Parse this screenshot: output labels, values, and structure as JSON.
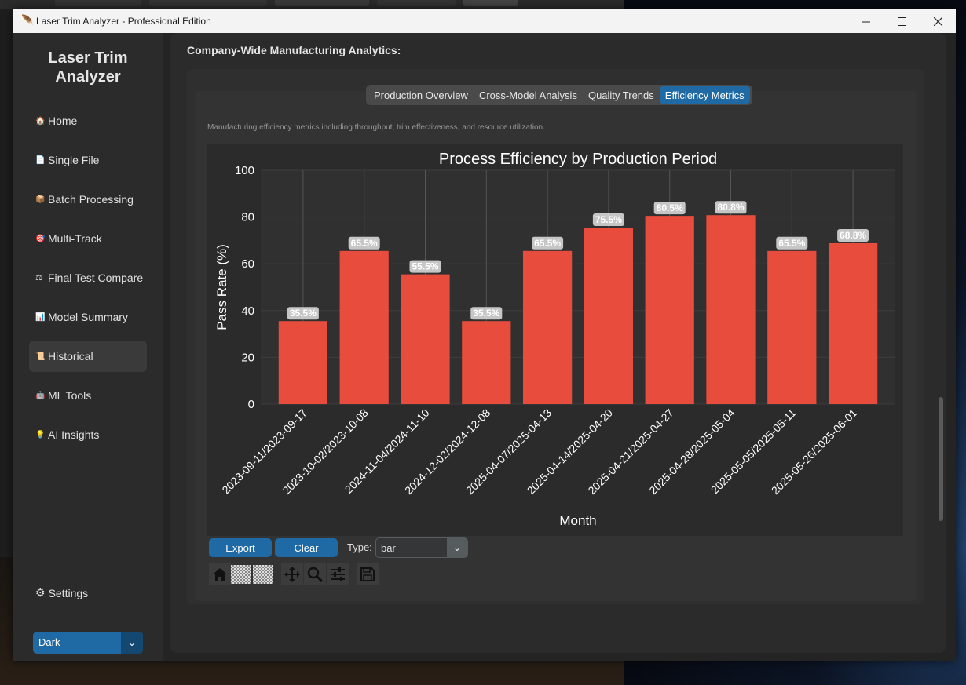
{
  "window": {
    "title": "Laser Trim Analyzer - Professional Edition"
  },
  "sidebar": {
    "app_name": "Laser Trim Analyzer",
    "items": [
      {
        "label": "Home",
        "icon": "home-icon",
        "glyph": "🏠"
      },
      {
        "label": "Single File",
        "icon": "file-icon",
        "glyph": "📄"
      },
      {
        "label": "Batch Processing",
        "icon": "package-icon",
        "glyph": "📦"
      },
      {
        "label": "Multi-Track",
        "icon": "target-icon",
        "glyph": "🎯"
      },
      {
        "label": "Final Test Compare",
        "icon": "scales-icon",
        "glyph": "⚖"
      },
      {
        "label": "Model Summary",
        "icon": "chart-icon",
        "glyph": "📊"
      },
      {
        "label": "Historical",
        "icon": "history-icon",
        "glyph": "📜"
      },
      {
        "label": "ML Tools",
        "icon": "robot-icon",
        "glyph": "🤖"
      },
      {
        "label": "AI Insights",
        "icon": "lightbulb-icon",
        "glyph": "💡"
      }
    ],
    "active_item": "Historical",
    "settings_label": "Settings",
    "theme_value": "Dark"
  },
  "main": {
    "section_title": "Company-Wide Manufacturing Analytics:",
    "tabs": [
      {
        "label": "Production Overview"
      },
      {
        "label": "Cross-Model Analysis"
      },
      {
        "label": "Quality Trends"
      },
      {
        "label": "Efficiency Metrics"
      }
    ],
    "active_tab": "Efficiency Metrics",
    "description": "Manufacturing efficiency metrics including throughput, trim effectiveness, and resource utilization.",
    "export_label": "Export",
    "clear_label": "Clear",
    "type_label": "Type:",
    "type_value": "bar"
  },
  "toolbar": {
    "items": [
      "home-icon",
      "back-icon",
      "forward-icon",
      "pan-icon",
      "zoom-icon",
      "configure-icon",
      "save-icon"
    ]
  },
  "colors": {
    "accent": "#1f6aa5",
    "bar": "#e74c3c",
    "chart_bg": "#2b2b2b",
    "plot_bg": "#303030"
  },
  "chart_data": {
    "type": "bar",
    "title": "Process Efficiency by Production Period",
    "xlabel": "Month",
    "ylabel": "Pass Rate (%)",
    "ylim": [
      0,
      100
    ],
    "yticks": [
      0,
      20,
      40,
      60,
      80,
      100
    ],
    "grid": true,
    "categories": [
      "2023-09-11/2023-09-17",
      "2023-10-02/2023-10-08",
      "2024-11-04/2024-11-10",
      "2024-12-02/2024-12-08",
      "2025-04-07/2025-04-13",
      "2025-04-14/2025-04-20",
      "2025-04-21/2025-04-27",
      "2025-04-28/2025-05-04",
      "2025-05-05/2025-05-11",
      "2025-05-26/2025-06-01"
    ],
    "values": [
      35.5,
      65.5,
      55.5,
      35.5,
      65.5,
      75.5,
      80.5,
      80.8,
      65.5,
      68.8
    ],
    "data_labels": [
      "35.5%",
      "65.5%",
      "55.5%",
      "35.5%",
      "65.5%",
      "75.5%",
      "80.5%",
      "80.8%",
      "65.5%",
      "68.8%"
    ]
  }
}
